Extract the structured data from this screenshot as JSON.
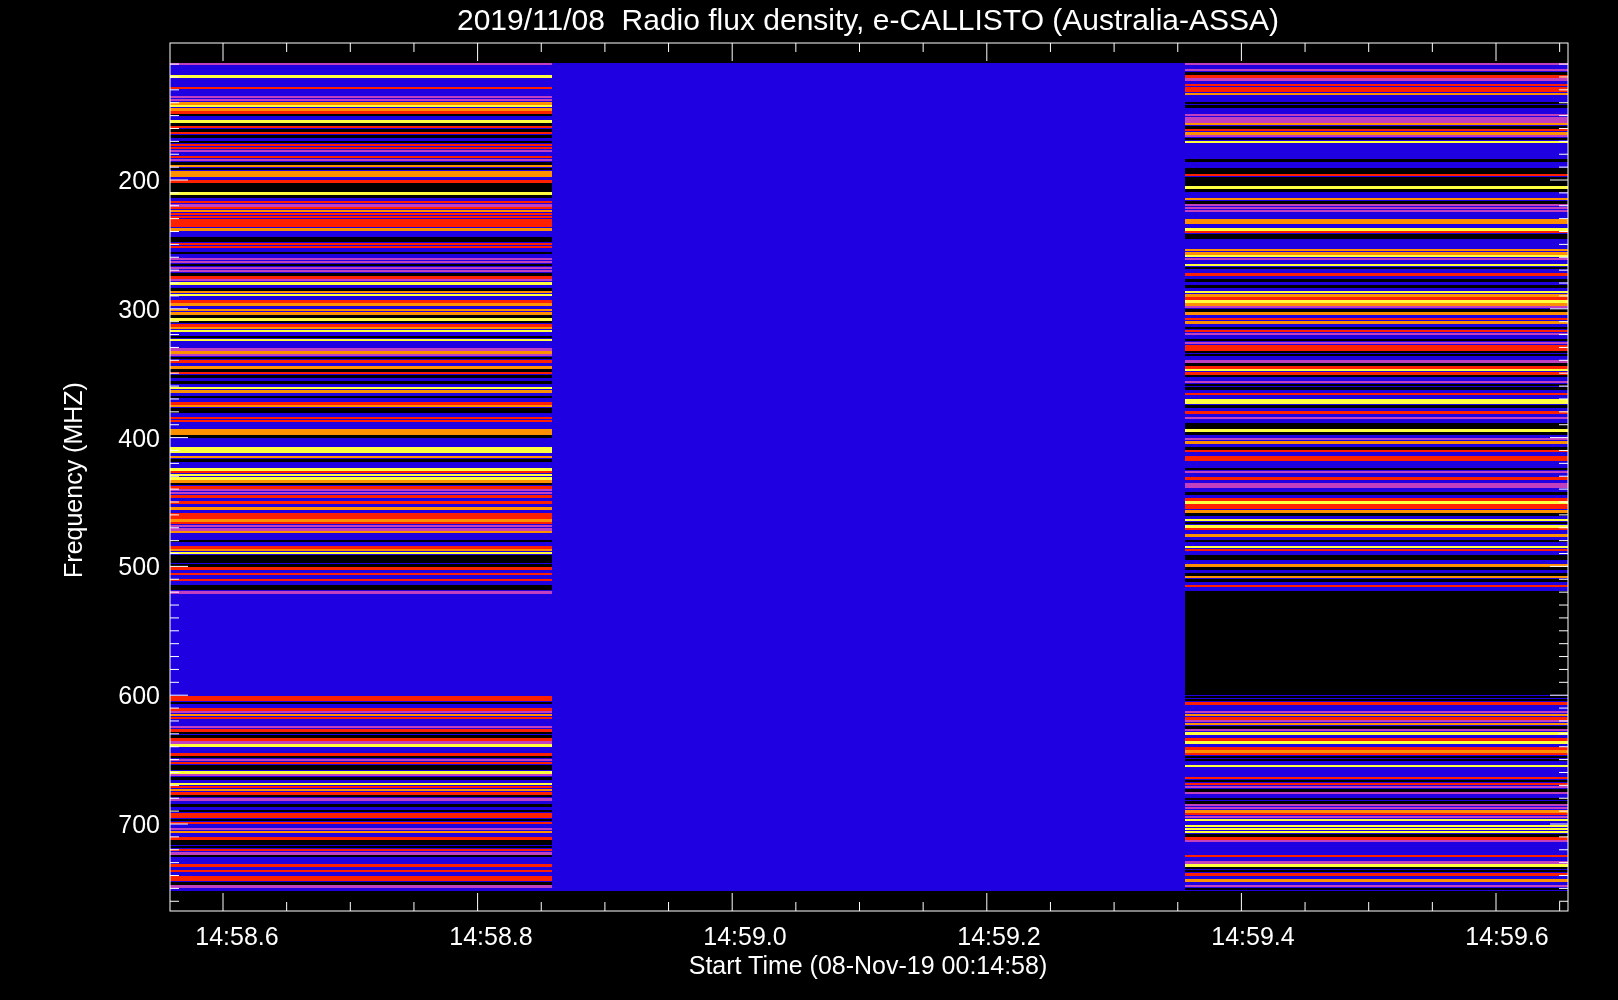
{
  "title": "2019/11/08  Radio flux density, e-CALLISTO (Australia-ASSA)",
  "y_axis": {
    "label": "Frequency (MHZ)",
    "tick_labels": [
      "200",
      "300",
      "400",
      "500",
      "600",
      "700"
    ]
  },
  "x_axis": {
    "label": "Start Time (08-Nov-19 00:14:58)",
    "tick_labels": [
      "14:58.6",
      "14:58.8",
      "14:59.0",
      "14:59.2",
      "14:59.4",
      "14:59.6"
    ]
  }
}
